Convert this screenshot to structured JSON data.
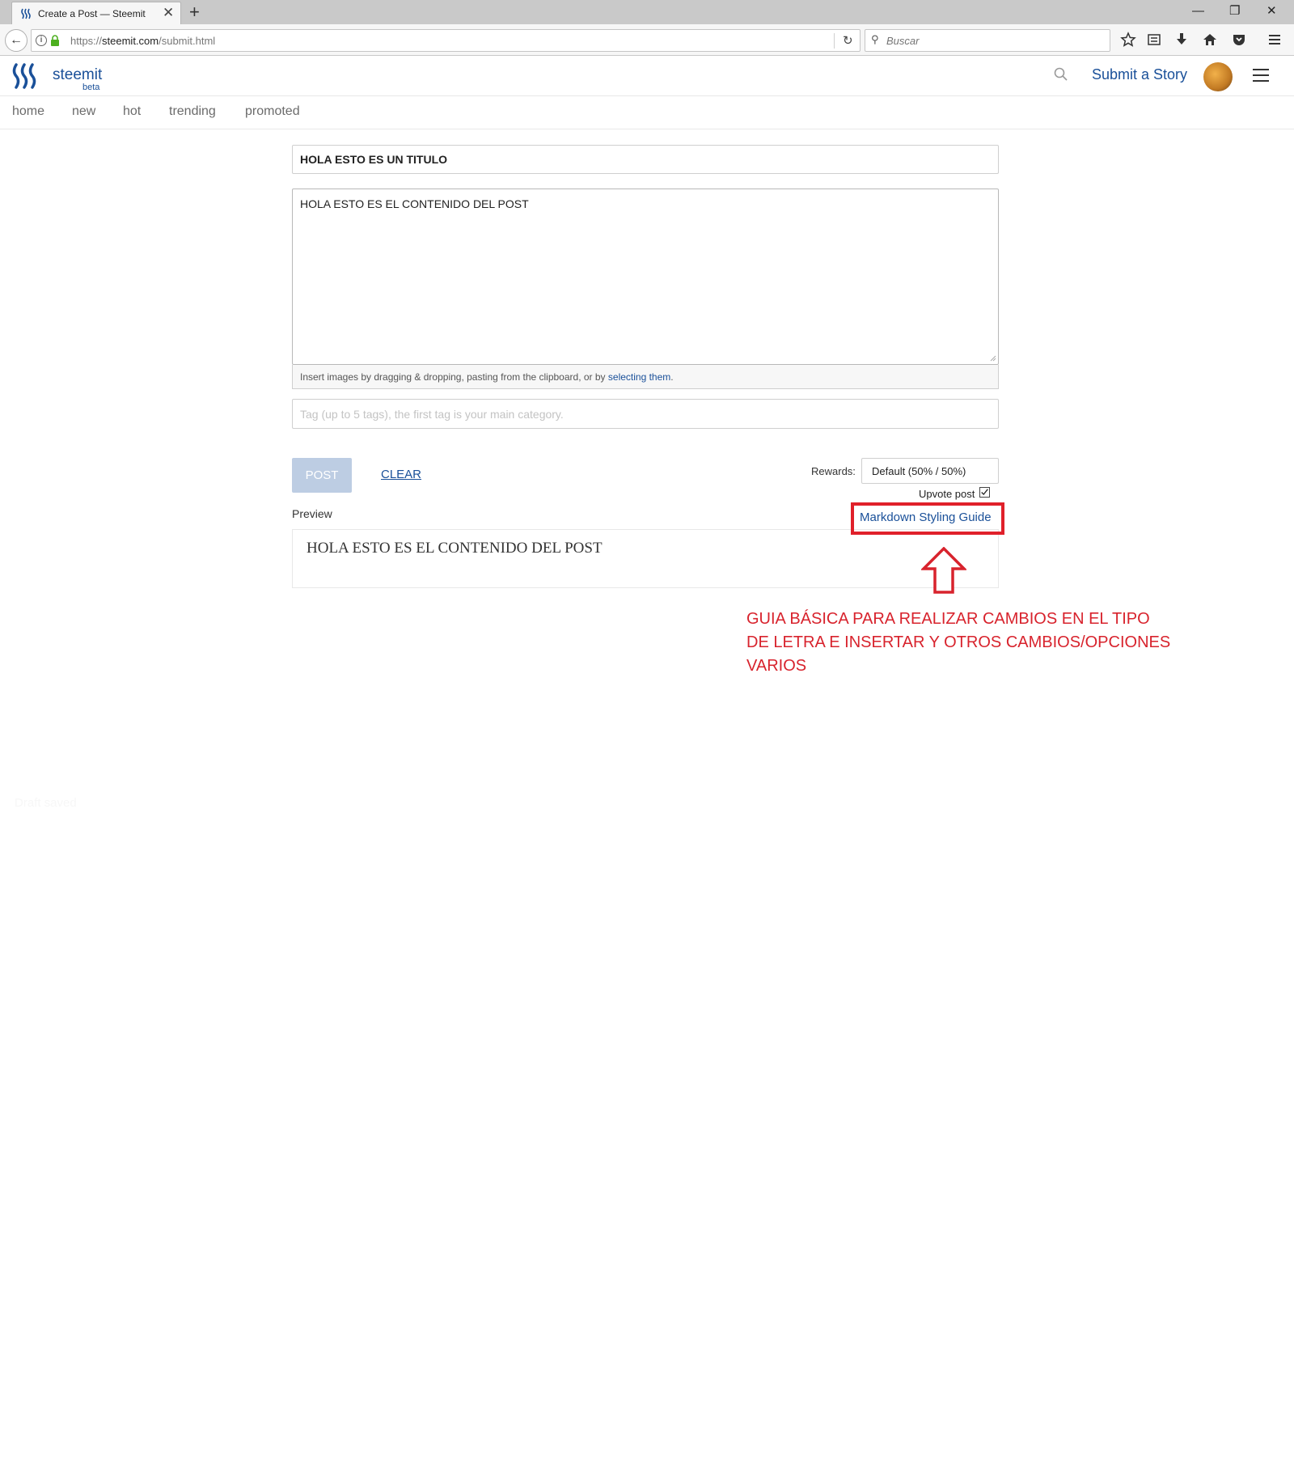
{
  "browser": {
    "tab_title": "Create a Post — Steemit",
    "new_tab": "+",
    "url_prefix": "https://",
    "url_host": "steemit.com",
    "url_path": "/submit.html",
    "search_placeholder": "Buscar",
    "controls": [
      "minimize-icon",
      "restore-icon",
      "close-icon"
    ]
  },
  "header": {
    "logo_text": "steemit",
    "logo_beta": "beta",
    "submit_label": "Submit a Story"
  },
  "subnav": {
    "items": [
      "home",
      "new",
      "hot",
      "trending",
      "promoted"
    ]
  },
  "editor": {
    "title_value": "HOLA ESTO ES UN TITULO",
    "body_value": "HOLA ESTO ES EL CONTENIDO DEL POST",
    "dropzone_text": "Insert images by dragging & dropping, pasting from the clipboard, or by ",
    "dropzone_link": "selecting them",
    "dropzone_end": ".",
    "tags_placeholder": "Tag (up to 5 tags), the first tag is your main category.",
    "post_label": "POST",
    "clear_label": "CLEAR",
    "rewards_label": "Rewards:",
    "rewards_value": "Default (50% / 50%)",
    "upvote_label": "Upvote post",
    "upvote_checked": true,
    "preview_label": "Preview",
    "markdown_guide": "Markdown Styling Guide",
    "preview_text": "HOLA ESTO ES EL CONTENIDO DEL POST"
  },
  "annotation": {
    "lines": [
      "GUIA BÁSICA PARA REALIZAR CAMBIOS EN EL TIPO",
      "DE LETRA E INSERTAR Y OTROS CAMBIOS/OPCIONES",
      "VARIOS"
    ],
    "color": "#d8232d"
  },
  "footer": {
    "draft_saved": "Draft saved"
  },
  "colors": {
    "brand": "#1a5099",
    "post_button": "#bdcde3",
    "highlight_box": "#e0202a"
  }
}
